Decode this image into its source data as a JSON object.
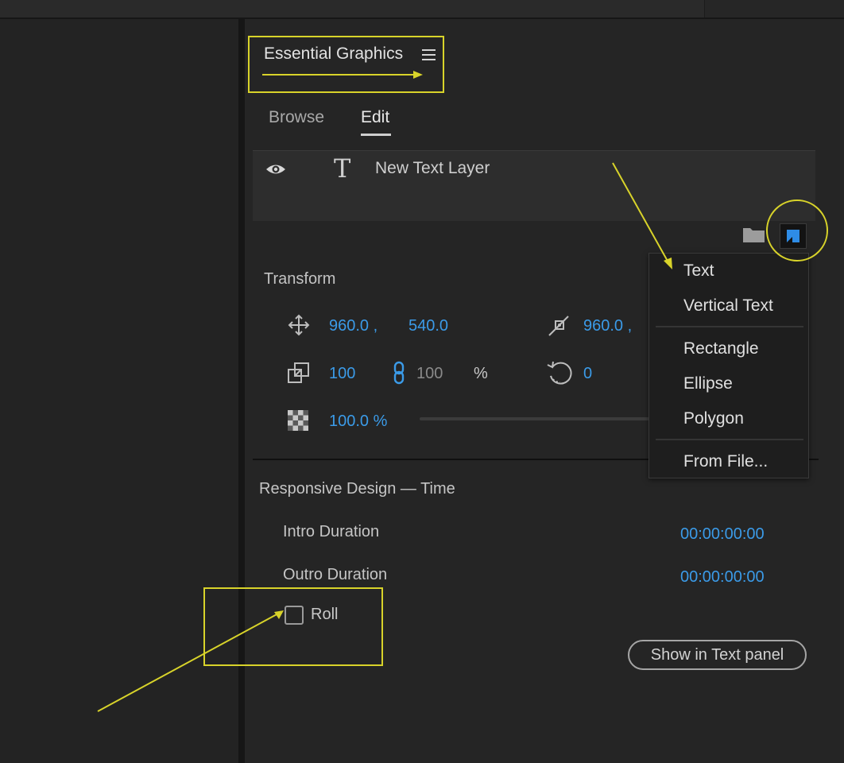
{
  "panel": {
    "title": "Essential Graphics",
    "menu_icon": "hamburger-icon",
    "tabs": [
      {
        "label": "Browse",
        "active": false
      },
      {
        "label": "Edit",
        "active": true
      }
    ]
  },
  "layer": {
    "name": "New Text Layer",
    "visibility_icon": "eye-icon",
    "type_icon": "text-layer-icon"
  },
  "toolbar": {
    "folder_icon": "folder-icon",
    "new_layer_icon": "new-layer-icon"
  },
  "new_layer_menu": {
    "items": [
      "Text",
      "Vertical Text",
      "Rectangle",
      "Ellipse",
      "Polygon",
      "From File..."
    ]
  },
  "transform": {
    "section_label": "Transform",
    "position_x": "960.0 ,",
    "position_y": "540.0",
    "anchor_x": "960.0 ,",
    "scale": "100",
    "scale_linked": "100",
    "scale_unit": "%",
    "rotation": "0",
    "opacity": "100.0 %"
  },
  "responsive": {
    "section_label": "Responsive Design — Time",
    "intro_label": "Intro Duration",
    "intro_value": "00:00:00:00",
    "outro_label": "Outro Duration",
    "outro_value": "00:00:00:00",
    "roll_label": "Roll",
    "roll_checked": false,
    "show_button": "Show in Text panel"
  },
  "colors": {
    "accent_blue": "#3b9be8",
    "annotation_yellow": "#d8d32a",
    "panel_bg": "#252525"
  }
}
